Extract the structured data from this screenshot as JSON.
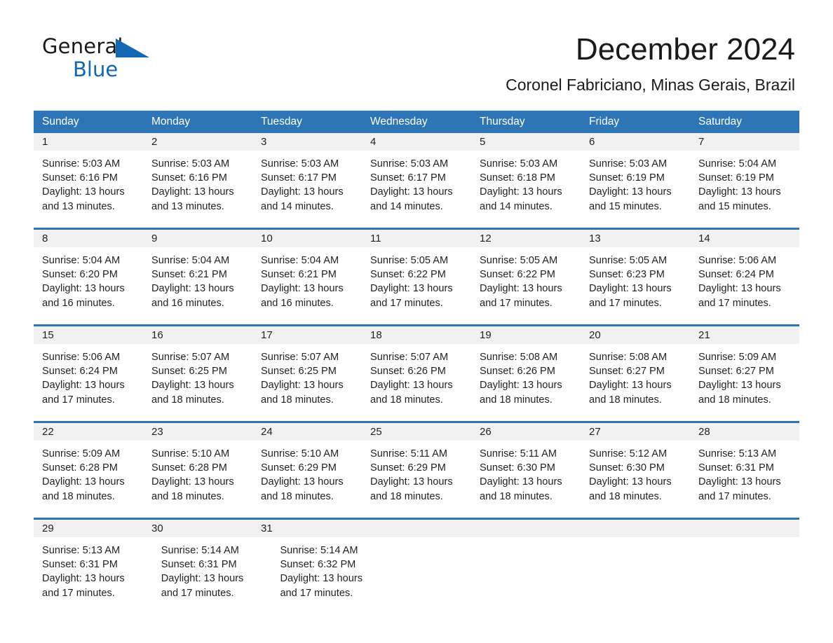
{
  "brand": {
    "name_part1": "General",
    "name_part2": "Blue",
    "flag_icon": "blue-triangle-flag-icon",
    "accent_color": "#1268b3"
  },
  "header": {
    "month_title": "December 2024",
    "location": "Coronel Fabriciano, Minas Gerais, Brazil"
  },
  "calendar": {
    "header_color": "#2e75b6",
    "daynum_band_color": "#f1f1f1",
    "weekdays": [
      "Sunday",
      "Monday",
      "Tuesday",
      "Wednesday",
      "Thursday",
      "Friday",
      "Saturday"
    ],
    "weeks": [
      {
        "days": [
          {
            "date": "1",
            "sunrise": "Sunrise: 5:03 AM",
            "sunset": "Sunset: 6:16 PM",
            "daylight_line1": "Daylight: 13 hours",
            "daylight_line2": "and 13 minutes."
          },
          {
            "date": "2",
            "sunrise": "Sunrise: 5:03 AM",
            "sunset": "Sunset: 6:16 PM",
            "daylight_line1": "Daylight: 13 hours",
            "daylight_line2": "and 13 minutes."
          },
          {
            "date": "3",
            "sunrise": "Sunrise: 5:03 AM",
            "sunset": "Sunset: 6:17 PM",
            "daylight_line1": "Daylight: 13 hours",
            "daylight_line2": "and 14 minutes."
          },
          {
            "date": "4",
            "sunrise": "Sunrise: 5:03 AM",
            "sunset": "Sunset: 6:17 PM",
            "daylight_line1": "Daylight: 13 hours",
            "daylight_line2": "and 14 minutes."
          },
          {
            "date": "5",
            "sunrise": "Sunrise: 5:03 AM",
            "sunset": "Sunset: 6:18 PM",
            "daylight_line1": "Daylight: 13 hours",
            "daylight_line2": "and 14 minutes."
          },
          {
            "date": "6",
            "sunrise": "Sunrise: 5:03 AM",
            "sunset": "Sunset: 6:19 PM",
            "daylight_line1": "Daylight: 13 hours",
            "daylight_line2": "and 15 minutes."
          },
          {
            "date": "7",
            "sunrise": "Sunrise: 5:04 AM",
            "sunset": "Sunset: 6:19 PM",
            "daylight_line1": "Daylight: 13 hours",
            "daylight_line2": "and 15 minutes."
          }
        ]
      },
      {
        "days": [
          {
            "date": "8",
            "sunrise": "Sunrise: 5:04 AM",
            "sunset": "Sunset: 6:20 PM",
            "daylight_line1": "Daylight: 13 hours",
            "daylight_line2": "and 16 minutes."
          },
          {
            "date": "9",
            "sunrise": "Sunrise: 5:04 AM",
            "sunset": "Sunset: 6:21 PM",
            "daylight_line1": "Daylight: 13 hours",
            "daylight_line2": "and 16 minutes."
          },
          {
            "date": "10",
            "sunrise": "Sunrise: 5:04 AM",
            "sunset": "Sunset: 6:21 PM",
            "daylight_line1": "Daylight: 13 hours",
            "daylight_line2": "and 16 minutes."
          },
          {
            "date": "11",
            "sunrise": "Sunrise: 5:05 AM",
            "sunset": "Sunset: 6:22 PM",
            "daylight_line1": "Daylight: 13 hours",
            "daylight_line2": "and 17 minutes."
          },
          {
            "date": "12",
            "sunrise": "Sunrise: 5:05 AM",
            "sunset": "Sunset: 6:22 PM",
            "daylight_line1": "Daylight: 13 hours",
            "daylight_line2": "and 17 minutes."
          },
          {
            "date": "13",
            "sunrise": "Sunrise: 5:05 AM",
            "sunset": "Sunset: 6:23 PM",
            "daylight_line1": "Daylight: 13 hours",
            "daylight_line2": "and 17 minutes."
          },
          {
            "date": "14",
            "sunrise": "Sunrise: 5:06 AM",
            "sunset": "Sunset: 6:24 PM",
            "daylight_line1": "Daylight: 13 hours",
            "daylight_line2": "and 17 minutes."
          }
        ]
      },
      {
        "days": [
          {
            "date": "15",
            "sunrise": "Sunrise: 5:06 AM",
            "sunset": "Sunset: 6:24 PM",
            "daylight_line1": "Daylight: 13 hours",
            "daylight_line2": "and 17 minutes."
          },
          {
            "date": "16",
            "sunrise": "Sunrise: 5:07 AM",
            "sunset": "Sunset: 6:25 PM",
            "daylight_line1": "Daylight: 13 hours",
            "daylight_line2": "and 18 minutes."
          },
          {
            "date": "17",
            "sunrise": "Sunrise: 5:07 AM",
            "sunset": "Sunset: 6:25 PM",
            "daylight_line1": "Daylight: 13 hours",
            "daylight_line2": "and 18 minutes."
          },
          {
            "date": "18",
            "sunrise": "Sunrise: 5:07 AM",
            "sunset": "Sunset: 6:26 PM",
            "daylight_line1": "Daylight: 13 hours",
            "daylight_line2": "and 18 minutes."
          },
          {
            "date": "19",
            "sunrise": "Sunrise: 5:08 AM",
            "sunset": "Sunset: 6:26 PM",
            "daylight_line1": "Daylight: 13 hours",
            "daylight_line2": "and 18 minutes."
          },
          {
            "date": "20",
            "sunrise": "Sunrise: 5:08 AM",
            "sunset": "Sunset: 6:27 PM",
            "daylight_line1": "Daylight: 13 hours",
            "daylight_line2": "and 18 minutes."
          },
          {
            "date": "21",
            "sunrise": "Sunrise: 5:09 AM",
            "sunset": "Sunset: 6:27 PM",
            "daylight_line1": "Daylight: 13 hours",
            "daylight_line2": "and 18 minutes."
          }
        ]
      },
      {
        "days": [
          {
            "date": "22",
            "sunrise": "Sunrise: 5:09 AM",
            "sunset": "Sunset: 6:28 PM",
            "daylight_line1": "Daylight: 13 hours",
            "daylight_line2": "and 18 minutes."
          },
          {
            "date": "23",
            "sunrise": "Sunrise: 5:10 AM",
            "sunset": "Sunset: 6:28 PM",
            "daylight_line1": "Daylight: 13 hours",
            "daylight_line2": "and 18 minutes."
          },
          {
            "date": "24",
            "sunrise": "Sunrise: 5:10 AM",
            "sunset": "Sunset: 6:29 PM",
            "daylight_line1": "Daylight: 13 hours",
            "daylight_line2": "and 18 minutes."
          },
          {
            "date": "25",
            "sunrise": "Sunrise: 5:11 AM",
            "sunset": "Sunset: 6:29 PM",
            "daylight_line1": "Daylight: 13 hours",
            "daylight_line2": "and 18 minutes."
          },
          {
            "date": "26",
            "sunrise": "Sunrise: 5:11 AM",
            "sunset": "Sunset: 6:30 PM",
            "daylight_line1": "Daylight: 13 hours",
            "daylight_line2": "and 18 minutes."
          },
          {
            "date": "27",
            "sunrise": "Sunrise: 5:12 AM",
            "sunset": "Sunset: 6:30 PM",
            "daylight_line1": "Daylight: 13 hours",
            "daylight_line2": "and 18 minutes."
          },
          {
            "date": "28",
            "sunrise": "Sunrise: 5:13 AM",
            "sunset": "Sunset: 6:31 PM",
            "daylight_line1": "Daylight: 13 hours",
            "daylight_line2": "and 17 minutes."
          }
        ]
      },
      {
        "days": [
          {
            "date": "29",
            "sunrise": "Sunrise: 5:13 AM",
            "sunset": "Sunset: 6:31 PM",
            "daylight_line1": "Daylight: 13 hours",
            "daylight_line2": "and 17 minutes."
          },
          {
            "date": "30",
            "sunrise": "Sunrise: 5:14 AM",
            "sunset": "Sunset: 6:31 PM",
            "daylight_line1": "Daylight: 13 hours",
            "daylight_line2": "and 17 minutes."
          },
          {
            "date": "31",
            "sunrise": "Sunrise: 5:14 AM",
            "sunset": "Sunset: 6:32 PM",
            "daylight_line1": "Daylight: 13 hours",
            "daylight_line2": "and 17 minutes."
          }
        ]
      }
    ]
  }
}
